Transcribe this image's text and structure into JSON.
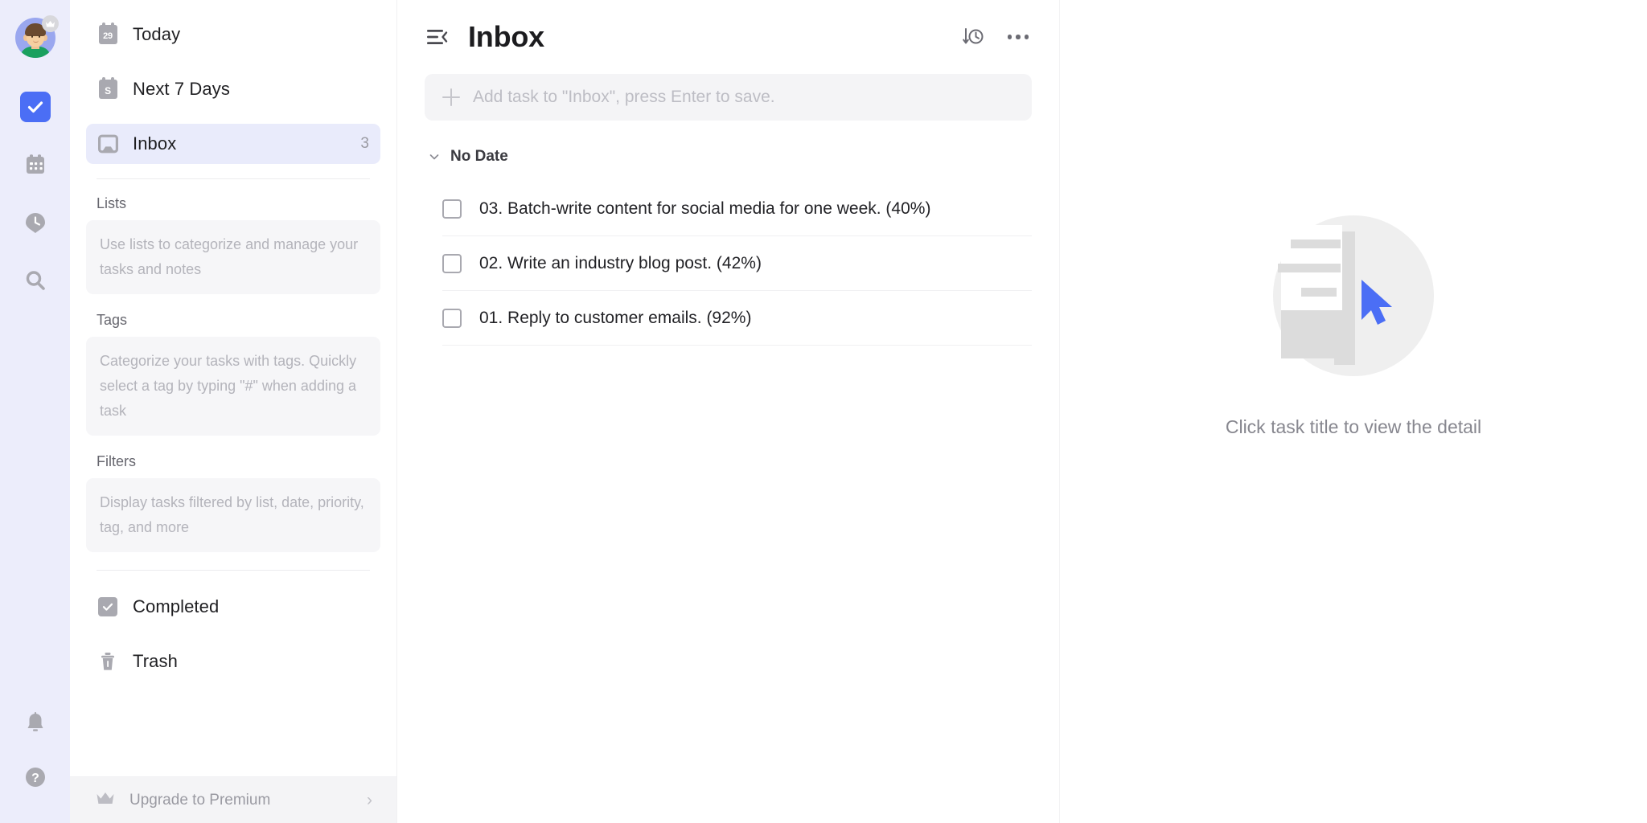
{
  "colors": {
    "rail_bg": "#ecedfb",
    "accent": "#4b6ef5",
    "selected_nav_bg": "#e9ebfb",
    "muted_text": "#b4b4bb",
    "panel_bg": "#f4f4f6"
  },
  "rail": {
    "avatar": {
      "name": "user-avatar",
      "badge": "premium-crown-badge"
    },
    "items": [
      {
        "icon": "tasks-check-icon",
        "label": "Tasks",
        "active": true
      },
      {
        "icon": "calendar-icon",
        "label": "Calendar",
        "active": false
      },
      {
        "icon": "pomodoro-clock-icon",
        "label": "Focus",
        "active": false
      },
      {
        "icon": "search-icon",
        "label": "Search",
        "active": false
      }
    ],
    "bottom_items": [
      {
        "icon": "bell-icon",
        "label": "Notifications"
      },
      {
        "icon": "help-icon",
        "label": "Help"
      }
    ]
  },
  "sidebar": {
    "nav": [
      {
        "icon": "calendar-29-icon",
        "label": "Today",
        "count": "",
        "selected": false
      },
      {
        "icon": "calendar-7days-icon",
        "label": "Next 7 Days",
        "count": "",
        "selected": false
      },
      {
        "icon": "inbox-tray-icon",
        "label": "Inbox",
        "count": "3",
        "selected": true
      }
    ],
    "sections": [
      {
        "title": "Lists",
        "hint": "Use lists to categorize and manage your tasks and notes"
      },
      {
        "title": "Tags",
        "hint": "Categorize your tasks with tags. Quickly select a tag by typing \"#\" when adding a task"
      },
      {
        "title": "Filters",
        "hint": "Display tasks filtered by list, date, priority, tag, and more"
      }
    ],
    "footer_nav": [
      {
        "icon": "completed-check-icon",
        "label": "Completed"
      },
      {
        "icon": "trash-icon",
        "label": "Trash"
      }
    ],
    "upgrade": {
      "icon": "crown-icon",
      "label": "Upgrade to Premium",
      "chevron": "›"
    }
  },
  "list_panel": {
    "collapse_icon": "collapse-sidebar-icon",
    "title": "Inbox",
    "actions": [
      {
        "icon": "sort-by-time-icon",
        "label": "Sort"
      },
      {
        "icon": "more-options-icon",
        "label": "More"
      }
    ],
    "add_task": {
      "icon": "plus-icon",
      "placeholder": "Add task to \"Inbox\", press Enter to save.",
      "value": ""
    },
    "group": {
      "chevron": "chevron-down-icon",
      "label": "No Date",
      "expanded": true
    },
    "tasks": [
      {
        "checked": false,
        "title": "03. Batch-write content for social media for one week. (40%)"
      },
      {
        "checked": false,
        "title": "02. Write an industry blog post. (42%)"
      },
      {
        "checked": false,
        "title": "01. Reply to customer emails. (92%)"
      }
    ]
  },
  "detail_panel": {
    "illustration": "empty-document-cursor-illustration",
    "empty_text": "Click task title to view the detail"
  }
}
